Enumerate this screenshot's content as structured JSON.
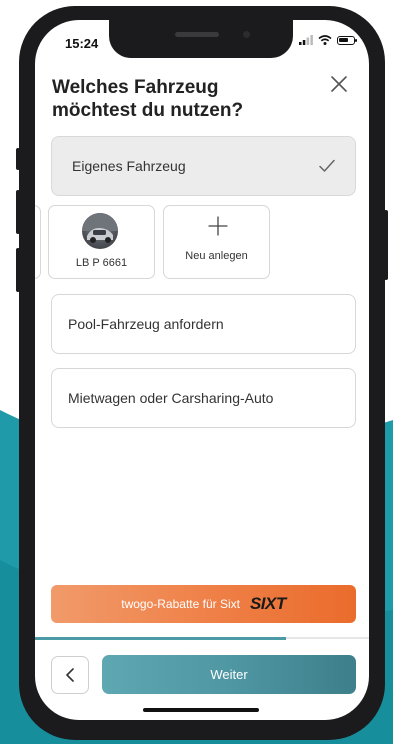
{
  "status_bar": {
    "time": "15:24"
  },
  "screen": {
    "title": "Welches Fahrzeug möchtest du nutzen?",
    "selected_option": {
      "label": "Eigenes Fahrzeug"
    },
    "vehicles": [
      {
        "plate": "LB P 6661"
      }
    ],
    "new_vehicle_label": "Neu anlegen",
    "options": [
      {
        "label": "Pool-Fahrzeug anfordern"
      },
      {
        "label": "Mietwagen oder Carsharing-Auto"
      }
    ],
    "banner": {
      "text": "twogo-Rabatte für Sixt",
      "brand": "SIXT"
    },
    "progress": 0.75,
    "next_button": "Weiter"
  },
  "colors": {
    "teal": "#1e9aa8",
    "accent_teal": "#4f97a3",
    "banner_orange": "#ef7f46",
    "selected_bg": "#ececec"
  }
}
